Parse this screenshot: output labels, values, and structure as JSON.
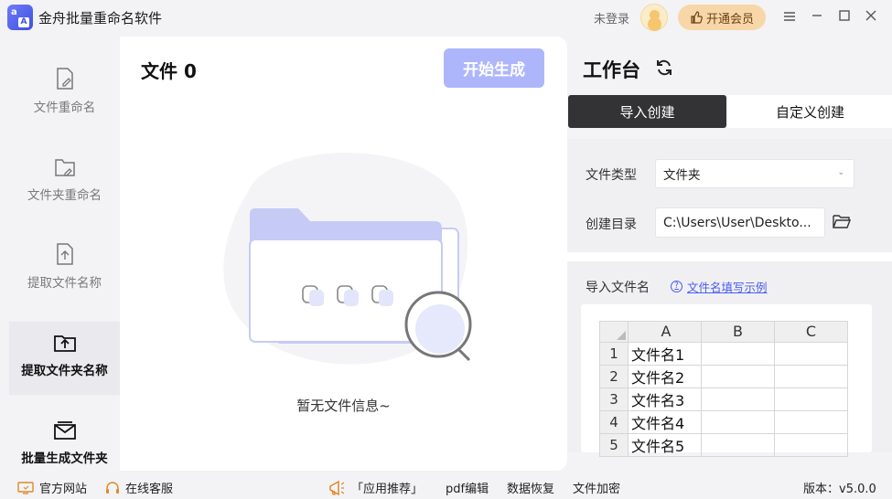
{
  "app": {
    "title": "金舟批量重命名软件",
    "logo_top": "a",
    "logo_bottom": "A"
  },
  "header": {
    "login_status": "未登录",
    "vip_label": "开通会员"
  },
  "sidebar": {
    "items": [
      {
        "label": "文件重命名",
        "icon": "file-edit-icon"
      },
      {
        "label": "文件夹重命名",
        "icon": "folder-edit-icon"
      },
      {
        "label": "提取文件名称",
        "icon": "file-upload-icon"
      },
      {
        "label": "提取文件夹名称",
        "icon": "folder-upload-icon"
      },
      {
        "label": "批量生成文件夹",
        "icon": "folder-stack-icon"
      }
    ]
  },
  "main": {
    "file_count": "文件 0",
    "start_label": "开始生成",
    "empty_text": "暂无文件信息~"
  },
  "workbench": {
    "title": "工作台",
    "tabs": [
      {
        "label": "导入创建"
      },
      {
        "label": "自定义创建"
      }
    ],
    "file_type_label": "文件类型",
    "file_type_value": "文件夹",
    "dir_label": "创建目录",
    "dir_value": "C:\\Users\\User\\Deskto...",
    "import_label": "导入文件名",
    "help_link": "文件名填写示例",
    "sheet": {
      "columns": [
        "A",
        "B",
        "C"
      ],
      "rows": [
        {
          "n": "1",
          "a": "文件名1"
        },
        {
          "n": "2",
          "a": "文件名2"
        },
        {
          "n": "3",
          "a": "文件名3"
        },
        {
          "n": "4",
          "a": "文件名4"
        },
        {
          "n": "5",
          "a": "文件名5"
        }
      ]
    }
  },
  "footer": {
    "website": "官方网站",
    "support": "在线客服",
    "recommend": "「应用推荐」",
    "pdf": "pdf编辑",
    "recover": "数据恢复",
    "encrypt": "文件加密",
    "version": "版本：v5.0.0"
  },
  "colors": {
    "accent": "#aeb6fb",
    "link": "#4a5cf2",
    "vip": "#f7d7a8",
    "tab_active": "#333335"
  }
}
